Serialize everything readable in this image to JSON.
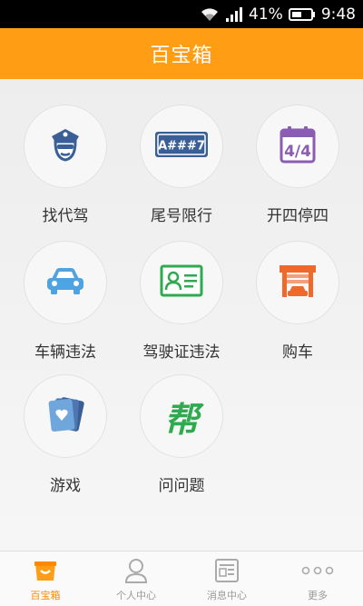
{
  "status_bar": {
    "battery_percent": "41%",
    "time": "9:48",
    "icons": [
      "wifi-icon",
      "signal-icon",
      "battery-icon"
    ]
  },
  "header": {
    "title": "百宝箱"
  },
  "tools": [
    {
      "label": "找代驾",
      "icon": "chauffeur-icon"
    },
    {
      "label": "尾号限行",
      "icon": "license-plate-icon",
      "plate_text": "A###7"
    },
    {
      "label": "开四停四",
      "icon": "calendar-icon",
      "calendar_text": "4/4"
    },
    {
      "label": "车辆违法",
      "icon": "car-icon"
    },
    {
      "label": "驾驶证违法",
      "icon": "driver-license-icon"
    },
    {
      "label": "购车",
      "icon": "garage-icon"
    },
    {
      "label": "游戏",
      "icon": "cards-icon"
    },
    {
      "label": "问问题",
      "icon": "help-icon",
      "icon_text": "帮"
    }
  ],
  "tab_bar": {
    "tabs": [
      {
        "label": "百宝箱",
        "icon": "toolbox-icon",
        "active": true
      },
      {
        "label": "个人中心",
        "icon": "person-icon",
        "active": false
      },
      {
        "label": "消息中心",
        "icon": "message-icon",
        "active": false
      },
      {
        "label": "更多",
        "icon": "more-icon",
        "active": false
      }
    ]
  },
  "colors": {
    "accent": "#ff9d14",
    "active_tab": "#ff8a00",
    "icon_blue": "#3a5f97",
    "icon_purple": "#8a5db3",
    "icon_green": "#2faa4f",
    "icon_orange": "#ef6a2a",
    "icon_sky": "#4ea3e0"
  }
}
